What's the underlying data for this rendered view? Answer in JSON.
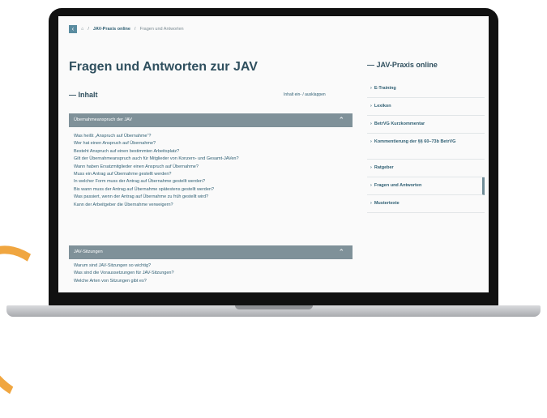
{
  "breadcrumb": {
    "back_icon": "chevron-left-icon",
    "home_icon": "home-icon",
    "items": [
      "JAV-Praxis online",
      "Fragen und Antworten"
    ]
  },
  "page": {
    "title": "Fragen und Antworten zur JAV",
    "inhalt": "— Inhalt",
    "toggle": "Inhalt ein- / ausklappen"
  },
  "sections": [
    {
      "title": "Übernahmeanspruch der JAV",
      "questions": [
        "Was heißt „Anspruch auf Übernahme“?",
        "Wer hat einen Anspruch auf Übernahme?",
        "Besteht Anspruch auf einen bestimmten Arbeitsplatz?",
        "Gilt der Übernahmeanspruch auch für Mitglieder von Konzern- und Gesamt-JAVen?",
        "Wann haben Ersatzmitglieder einen Anspruch auf Übernahme?",
        "Muss ein Antrag auf Übernahme gestellt werden?",
        "In welcher Form muss der Antrag auf Übernahme gestellt werden?",
        "Bis wann muss der Antrag auf Übernahme spätestens gestellt werden?",
        "Was passiert, wenn der Antrag auf Übernahme zu früh gestellt wird?",
        "Kann der Arbeitgeber die Übernahme verweigern?"
      ]
    },
    {
      "title": "JAV-Sitzungen",
      "questions": [
        "Warum sind JAV-Sitzungen so wichtig?",
        "Was sind die Voraussetzungen für JAV-Sitzungen?",
        "Welche Arten von Sitzungen gibt es?"
      ]
    }
  ],
  "sidebar": {
    "title": "— JAV-Praxis online",
    "items": [
      {
        "label": "E-Training",
        "active": false
      },
      {
        "label": "Lexikon",
        "active": false
      },
      {
        "label": "BetrVG Kurzkommentar",
        "active": false
      },
      {
        "label": "Kommentierung der §§ 60–73b BetrVG",
        "active": false
      },
      {
        "label": "Ratgeber",
        "active": false
      },
      {
        "label": "Fragen und Antworten",
        "active": true
      },
      {
        "label": "Mustertexte",
        "active": false
      }
    ]
  },
  "colors": {
    "accent": "#7f9199",
    "link": "#2f5f73",
    "heading": "#2f4f5e",
    "arc": "#f0a640"
  }
}
